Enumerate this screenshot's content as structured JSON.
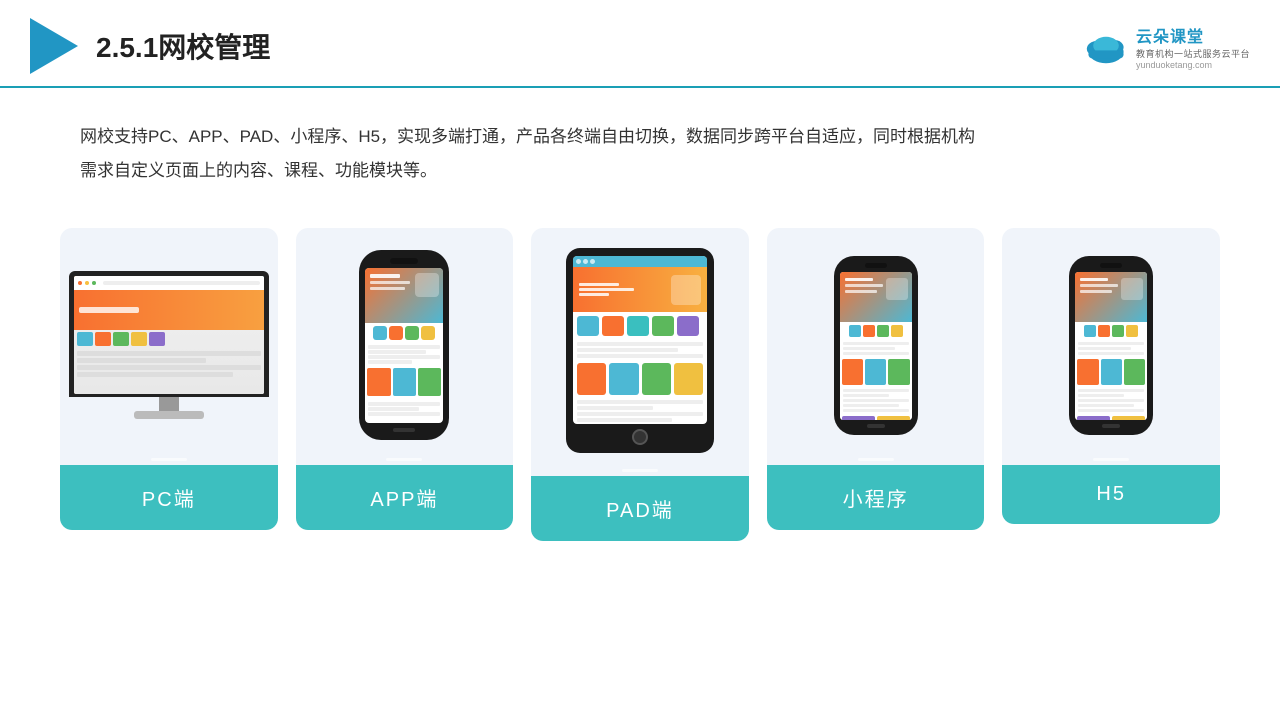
{
  "header": {
    "title": "2.5.1网校管理",
    "brand_name": "云朵课堂",
    "brand_tagline": "教育机构一站式服务云平台",
    "brand_domain": "yunduoketang.com"
  },
  "description": {
    "text1": "网校支持PC、APP、PAD、小程序、H5，实现多端打通，产品各终端自由切换，数据同步跨平台自适应，同时根据机构",
    "text2": "需求自定义页面上的内容、课程、功能模块等。"
  },
  "cards": [
    {
      "id": "pc",
      "label": "PC端"
    },
    {
      "id": "app",
      "label": "APP端"
    },
    {
      "id": "pad",
      "label": "PAD端"
    },
    {
      "id": "mini",
      "label": "小程序"
    },
    {
      "id": "h5",
      "label": "H5"
    }
  ]
}
